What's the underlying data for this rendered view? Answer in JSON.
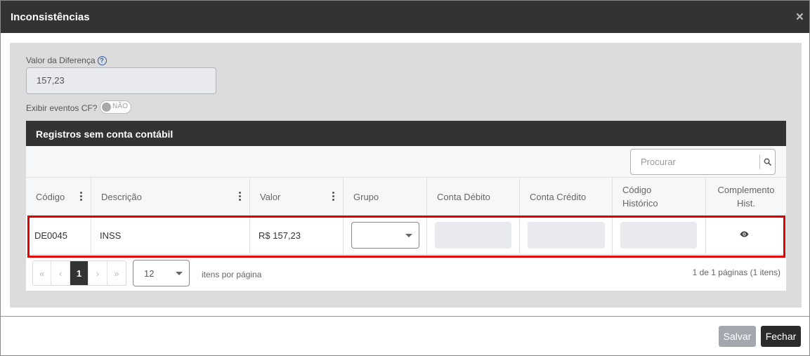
{
  "modal": {
    "title": "Inconsistências",
    "close_glyph": "×"
  },
  "form": {
    "diff_label": "Valor da Diferença",
    "diff_value": "157,23",
    "help_glyph": "?",
    "cf_label": "Exibir eventos CF?",
    "cf_toggle_text": "NÃO"
  },
  "panel": {
    "title": "Registros sem conta contábil",
    "search_placeholder": "Procurar"
  },
  "table": {
    "headers": {
      "codigo": "Código",
      "descricao": "Descrição",
      "valor": "Valor",
      "grupo": "Grupo",
      "conta_debito": "Conta Débito",
      "conta_credito": "Conta Crédito",
      "codigo_historico_l1": "Código",
      "codigo_historico_l2": "Histórico",
      "complemento_l1": "Complemento",
      "complemento_l2": "Hist."
    },
    "rows": [
      {
        "codigo": "DE0045",
        "descricao": "INSS",
        "valor": "R$ 157,23",
        "grupo": ""
      }
    ]
  },
  "pagination": {
    "first": "«",
    "prev": "‹",
    "current": "1",
    "next": "›",
    "last": "»",
    "page_size": "12",
    "per_page_label": "itens por página",
    "info": "1 de 1 páginas (1 itens)"
  },
  "footer": {
    "save_label": "Salvar",
    "close_label": "Fechar"
  },
  "colors": {
    "header_bg": "#333333",
    "body_bg": "#dcdcdc",
    "highlight": "#e00000",
    "save_btn": "#a4a7ad",
    "close_btn": "#2b2b2b"
  },
  "icons": {
    "help": "help-circle-icon",
    "search": "search-icon",
    "menu": "kebab-menu-icon",
    "view": "eye-icon",
    "close": "close-icon",
    "dropdown": "chevron-down-icon"
  }
}
